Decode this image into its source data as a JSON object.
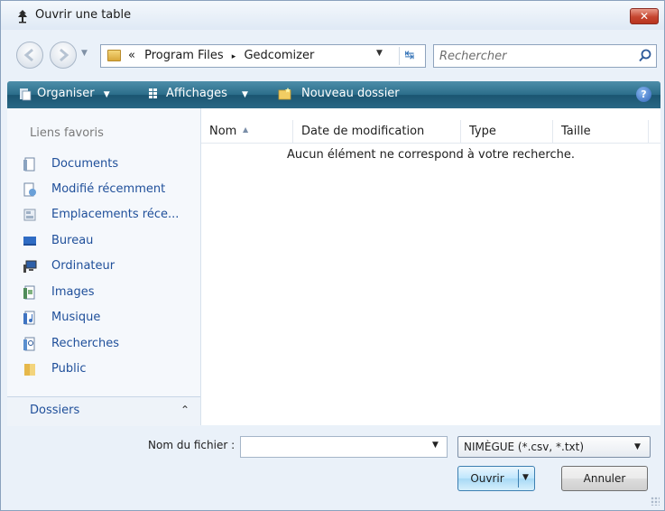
{
  "window": {
    "title": "Ouvrir une table",
    "close_label": "✕"
  },
  "nav": {
    "breadcrumb_prefix": "«",
    "breadcrumbs": [
      "Program Files",
      "Gedcomizer"
    ],
    "breadcrumb_separator": "▸",
    "search_placeholder": "Rechercher"
  },
  "toolbar": {
    "organiser": "Organiser",
    "affichages": "Affichages",
    "nouveau_dossier": "Nouveau dossier",
    "dropdown_glyph": "▼",
    "help_glyph": "?"
  },
  "sidebar": {
    "favorites_header": "Liens favoris",
    "items": [
      {
        "label": "Documents",
        "icon": "documents-icon"
      },
      {
        "label": "Modifié récemment",
        "icon": "recent-icon"
      },
      {
        "label": "Emplacements réce...",
        "icon": "recent-places-icon"
      },
      {
        "label": "Bureau",
        "icon": "desktop-icon"
      },
      {
        "label": "Ordinateur",
        "icon": "computer-icon"
      },
      {
        "label": "Images",
        "icon": "images-icon"
      },
      {
        "label": "Musique",
        "icon": "music-icon"
      },
      {
        "label": "Recherches",
        "icon": "searches-icon"
      },
      {
        "label": "Public",
        "icon": "public-folder-icon"
      }
    ],
    "folders_label": "Dossiers",
    "folders_chevron": "⌃"
  },
  "file_list": {
    "columns": [
      "Nom",
      "Date de modification",
      "Type",
      "Taille"
    ],
    "empty_message": "Aucun élément ne correspond à votre recherche."
  },
  "footer": {
    "filename_label": "Nom du fichier :",
    "filename_value": "",
    "filetype_value": "NIMÈGUE (*.csv, *.txt)",
    "open_label": "Ouvrir",
    "cancel_label": "Annuler"
  },
  "colors": {
    "toolbar": "#2b6d8a",
    "link": "#1f4f9a",
    "close": "#c6452f"
  }
}
